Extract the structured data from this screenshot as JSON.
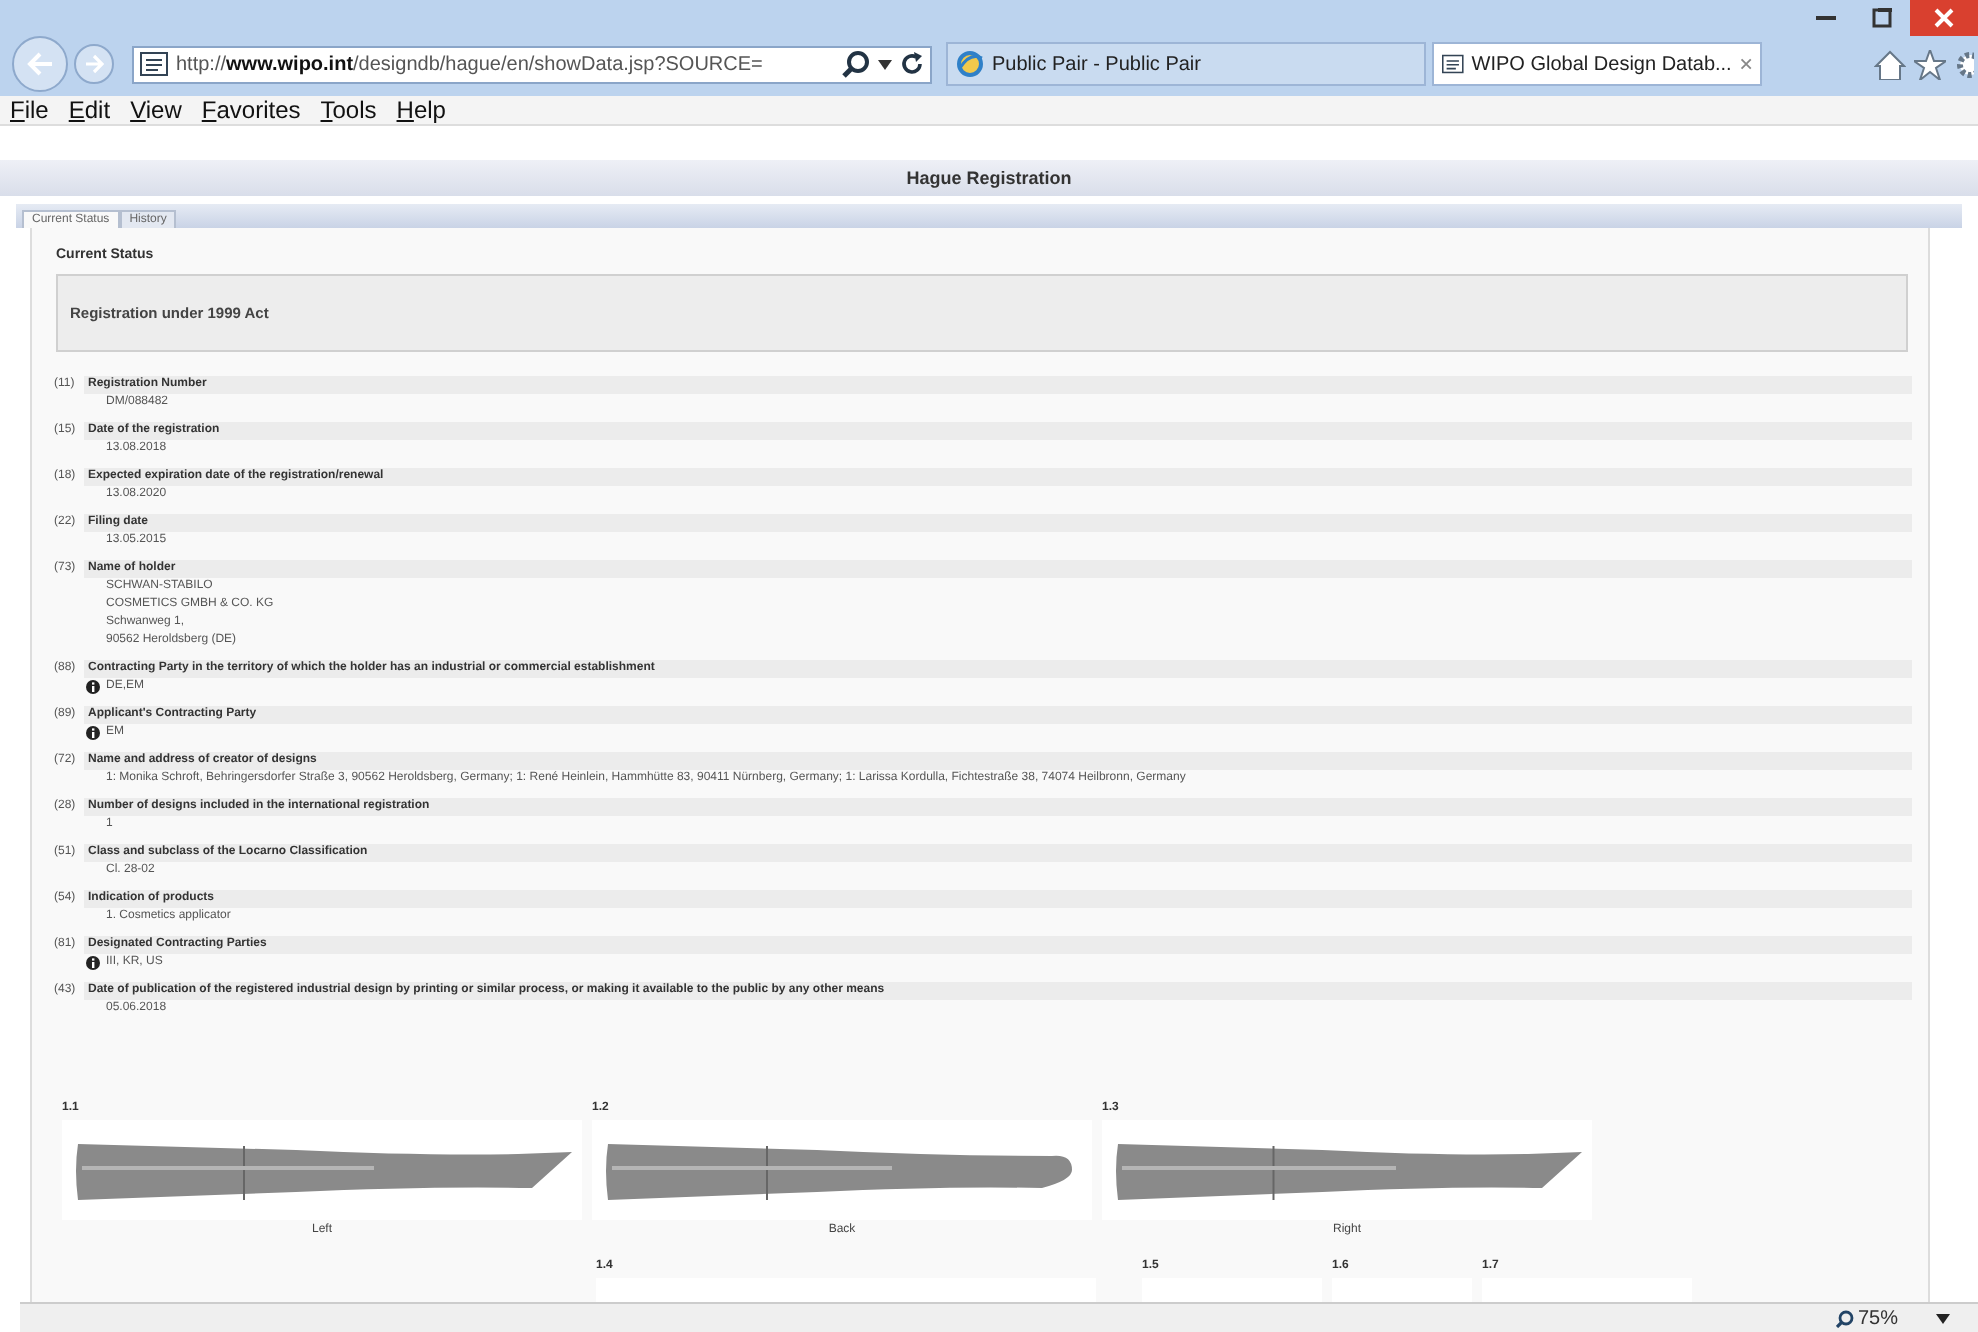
{
  "browser": {
    "address": "http://**www.wipo.int**/designdb/hague/en/showData.jsp?SOURCE=",
    "tabs": [
      {
        "label": "Public Pair - Public Pair",
        "selected": false
      },
      {
        "label": "WIPO Global Design Datab...",
        "selected": true
      }
    ]
  },
  "menu": [
    "File",
    "Edit",
    "View",
    "Favorites",
    "Tools",
    "Help"
  ],
  "page_title": "Hague Registration",
  "page_tabs": [
    {
      "label": "Current Status",
      "selected": true
    },
    {
      "label": "History",
      "selected": false
    }
  ],
  "section_title": "Current Status",
  "status_box": "Registration under 1999 Act",
  "fields": [
    {
      "code": "(11)",
      "label": "Registration Number",
      "values": [
        "DM/088482"
      ],
      "info": false
    },
    {
      "code": "(15)",
      "label": "Date of the registration",
      "values": [
        "13.08.2018"
      ],
      "info": false
    },
    {
      "code": "(18)",
      "label": "Expected expiration date of the registration/renewal",
      "values": [
        "13.08.2020"
      ],
      "info": false
    },
    {
      "code": "(22)",
      "label": "Filing date",
      "values": [
        "13.05.2015"
      ],
      "info": false
    },
    {
      "code": "(73)",
      "label": "Name of holder",
      "values": [
        "SCHWAN-STABILO",
        "COSMETICS GMBH & CO. KG",
        "Schwanweg 1,",
        "90562 Heroldsberg (DE)"
      ],
      "info": false
    },
    {
      "code": "(88)",
      "label": "Contracting Party in the territory of which the holder has an industrial or commercial establishment",
      "values": [
        "DE,EM"
      ],
      "info": true
    },
    {
      "code": "(89)",
      "label": "Applicant's Contracting Party",
      "values": [
        "EM"
      ],
      "info": true
    },
    {
      "code": "(72)",
      "label": "Name and address of creator of designs",
      "values": [
        "1: Monika Schroft, Behringersdorfer Straße 3, 90562 Heroldsberg, Germany; 1: René Heinlein, Hammhütte 83, 90411 Nürnberg, Germany; 1: Larissa Kordulla, Fichtestraße 38, 74074 Heilbronn, Germany"
      ],
      "info": false
    },
    {
      "code": "(28)",
      "label": "Number of designs included in the international registration",
      "values": [
        "1"
      ],
      "info": false
    },
    {
      "code": "(51)",
      "label": "Class and subclass of the Locarno Classification",
      "values": [
        "Cl. 28-02"
      ],
      "info": false
    },
    {
      "code": "(54)",
      "label": "Indication of products",
      "values": [
        "1. Cosmetics applicator"
      ],
      "info": false
    },
    {
      "code": "(81)",
      "label": "Designated Contracting Parties",
      "values": [
        "III, KR, US"
      ],
      "info": true
    },
    {
      "code": "(43)",
      "label": "Date of publication of the registered industrial design by printing or similar process, or making it available to the public by any other means",
      "values": [
        "05.06.2018"
      ],
      "info": false
    }
  ],
  "designs": [
    {
      "number": "1.1",
      "caption": "Left"
    },
    {
      "number": "1.2",
      "caption": "Back"
    },
    {
      "number": "1.3",
      "caption": "Right"
    },
    {
      "number": "1.4"
    },
    {
      "number": "1.5"
    },
    {
      "number": "1.6"
    },
    {
      "number": "1.7"
    }
  ],
  "zoom": "75%"
}
